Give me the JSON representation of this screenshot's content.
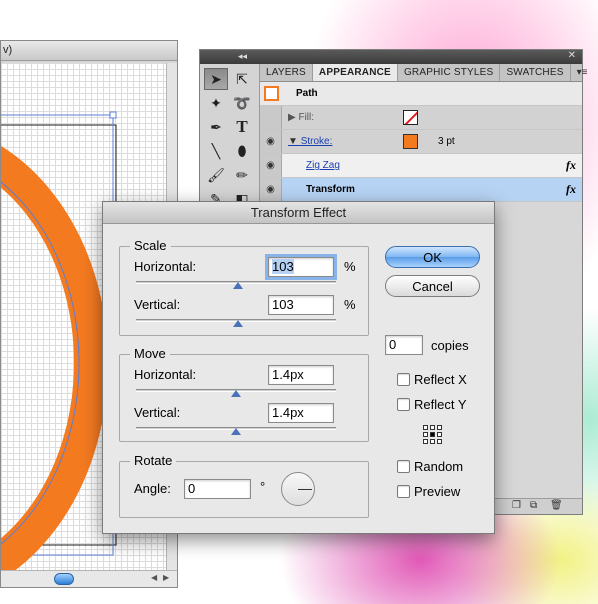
{
  "colors": {
    "artwork_orange": "#f47a20",
    "selection_blue": "#b7d3f4",
    "ok_button": "#6aa8ec"
  },
  "doc_window": {
    "title_fragment": "v)"
  },
  "appearance_panel": {
    "tabs": [
      "LAYERS",
      "APPEARANCE",
      "GRAPHIC STYLES",
      "SWATCHES"
    ],
    "active_tab": "APPEARANCE",
    "path_label": "Path",
    "fill_label": "Fill:",
    "stroke_label": "Stroke:",
    "stroke_weight": "3 pt",
    "effects": [
      {
        "label": "Zig Zag",
        "fx": "fx"
      },
      {
        "label": "Transform",
        "fx": "fx"
      }
    ]
  },
  "dialog": {
    "title": "Transform Effect",
    "scale": {
      "legend": "Scale",
      "horizontal_label": "Horizontal:",
      "horizontal_value": "103",
      "horizontal_unit": "%",
      "vertical_label": "Vertical:",
      "vertical_value": "103",
      "vertical_unit": "%"
    },
    "move": {
      "legend": "Move",
      "horizontal_label": "Horizontal:",
      "horizontal_value": "1.4px",
      "vertical_label": "Vertical:",
      "vertical_value": "1.4px"
    },
    "rotate": {
      "legend": "Rotate",
      "angle_label": "Angle:",
      "angle_value": "0",
      "angle_unit": "°"
    },
    "ok_label": "OK",
    "cancel_label": "Cancel",
    "copies_value": "0",
    "copies_label": "copies",
    "reflect_x_label": "Reflect X",
    "reflect_y_label": "Reflect Y",
    "random_label": "Random",
    "preview_label": "Preview"
  }
}
